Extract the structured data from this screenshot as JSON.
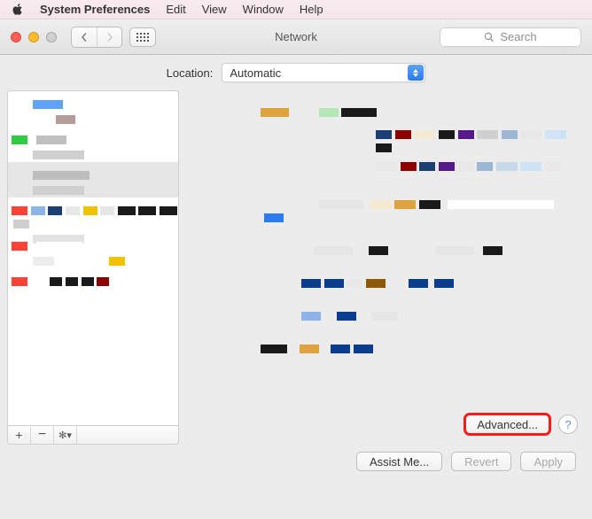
{
  "menubar": {
    "app": "System Preferences",
    "items": [
      "Edit",
      "View",
      "Window",
      "Help"
    ]
  },
  "toolbar": {
    "title": "Network",
    "search_placeholder": "Search"
  },
  "location": {
    "label": "Location:",
    "value": "Automatic"
  },
  "sidebar": {
    "add_label": "+",
    "remove_label": "−"
  },
  "detail": {
    "advanced_label": "Advanced...",
    "help_label": "?"
  },
  "bottom": {
    "assist_label": "Assist Me...",
    "revert_label": "Revert",
    "apply_label": "Apply"
  }
}
